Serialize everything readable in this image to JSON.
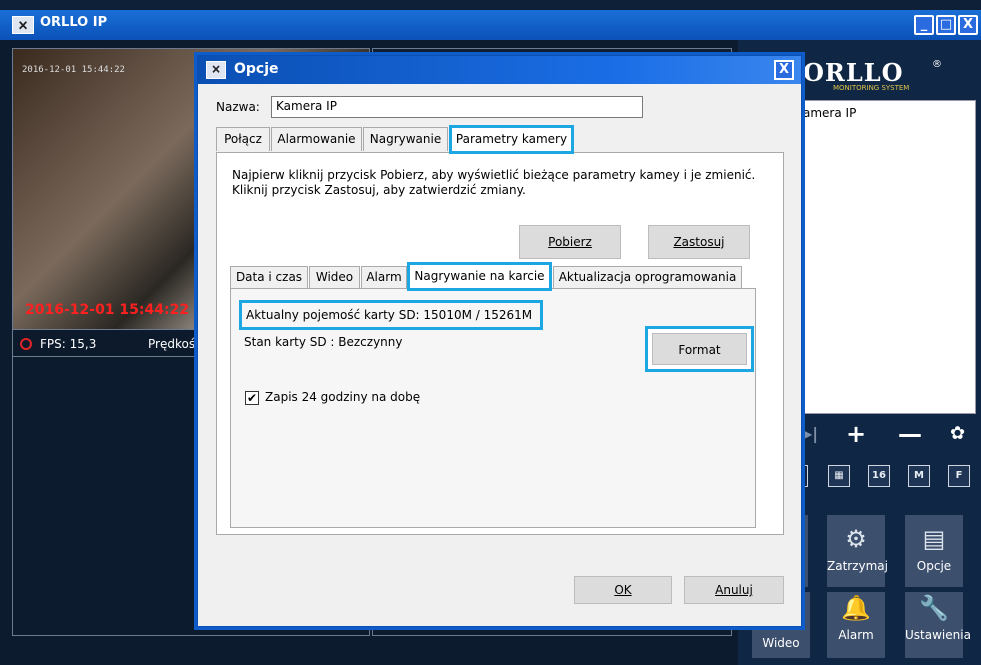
{
  "main_window": {
    "title": "ORLLO IP",
    "logo_text": "🗙",
    "controls": {
      "minimize": "_",
      "maximize": "□",
      "close": "X"
    }
  },
  "video": {
    "timestamp_small": "2016-12-01 15:44:22",
    "timestamp_red": "2016-12-01 15:44:22",
    "fps_label": "FPS: 15,3",
    "speed_label": "Prędkoś"
  },
  "right_panel": {
    "brand": "ORLLO",
    "brand_reg": "®",
    "brand_sub": "MONITORING SYSTEM",
    "camera_list": [
      "amera IP"
    ],
    "controls": {
      "next": "▶|",
      "add": "+",
      "remove": "—",
      "settings": "✿"
    },
    "grid_buttons": [
      "▦",
      "16",
      "M",
      "F"
    ],
    "buttons": {
      "zatrzymaj": "Zatrzymaj",
      "opcje": "Opcje",
      "wideo": "Wideo",
      "alarm": "Alarm",
      "ustawienia": "Ustawienia"
    },
    "icons": {
      "zatrzymaj": "⚙",
      "opcje": "▤",
      "alarm": "🔔",
      "ustawienia": "🔧"
    }
  },
  "dialog": {
    "title": "Opcje",
    "logo_text": "🗙",
    "close": "X",
    "name_label": "Nazwa:",
    "name_value": "Kamera IP",
    "tabs": [
      "Połącz",
      "Alarmowanie",
      "Nagrywanie",
      "Parametry kamery"
    ],
    "info_line1": "Najpierw kliknij przycisk Pobierz, aby wyświetlić bieżące parametry kamey i  je zmienić.",
    "info_line2": "Kliknij przycisk Zastosuj, aby zatwierdzić zmiany.",
    "pobierz": "Pobierz",
    "zastosuj": "Zastosuj",
    "inner_tabs": [
      "Data i czas",
      "Wideo",
      "Alarm",
      "Nagrywanie na karcie",
      "Aktualizacja oprogramowania"
    ],
    "sd_capacity": "Aktualny pojemość karty SD: 15010M / 15261M",
    "sd_state": "Stan karty SD : Bezczynny",
    "format": "Format",
    "checkbox_mark": "✔",
    "checkbox_label": "Zapis 24 godziny na dobę",
    "checkbox_checked": true,
    "ok": "OK",
    "cancel": "Anuluj"
  },
  "colors": {
    "highlight": "#1ca7e3",
    "titlebar": "#0a52b9",
    "panel_bg": "#0f2745"
  }
}
